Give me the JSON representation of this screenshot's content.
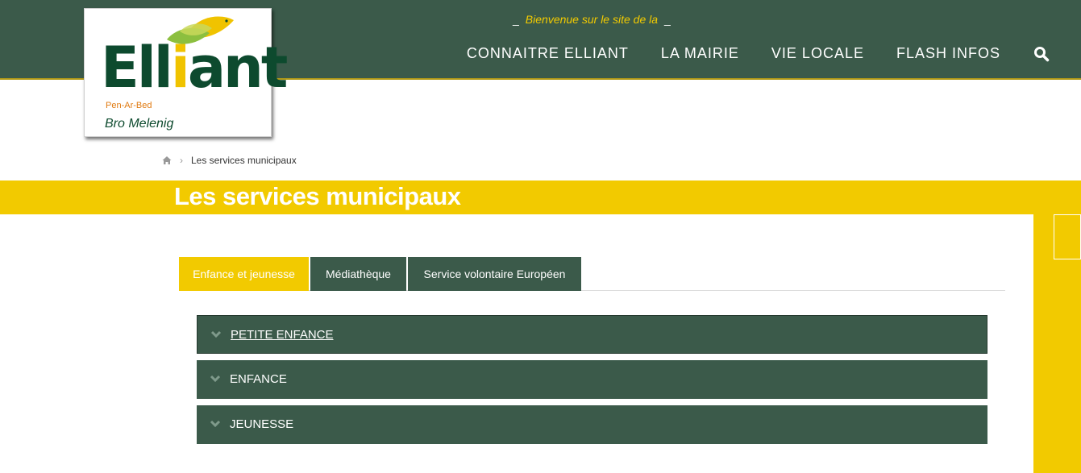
{
  "colors": {
    "header_green": "#3b5a4a",
    "accent_yellow": "#f2ca00"
  },
  "logo": {
    "word_main": "Ell",
    "word_accent": "i",
    "word_end": "ant",
    "subtitle": "Pen-Ar-Bed",
    "tagline": "Bro Melenig"
  },
  "header": {
    "welcome_dash_left": "_",
    "welcome_text": "Bienvenue sur le site de la",
    "welcome_dash_right": "_",
    "nav": [
      {
        "label": "CONNAITRE ELLIANT"
      },
      {
        "label": "LA MAIRIE"
      },
      {
        "label": "VIE LOCALE"
      },
      {
        "label": "FLASH INFOS"
      }
    ],
    "search_icon": "search-icon"
  },
  "breadcrumb": {
    "home_icon": "home-icon",
    "separator": "›",
    "current": "Les services municipaux"
  },
  "page": {
    "title": "Les services municipaux"
  },
  "tabs": [
    {
      "label": "Enfance et jeunesse",
      "active": true
    },
    {
      "label": "Médiathèque",
      "active": false
    },
    {
      "label": "Service volontaire Européen",
      "active": false
    }
  ],
  "accordion": [
    {
      "label": "PETITE ENFANCE",
      "icon": "chevron-down-icon"
    },
    {
      "label": "ENFANCE",
      "icon": "chevron-down-icon"
    },
    {
      "label": "JEUNESSE",
      "icon": "chevron-down-icon"
    }
  ]
}
